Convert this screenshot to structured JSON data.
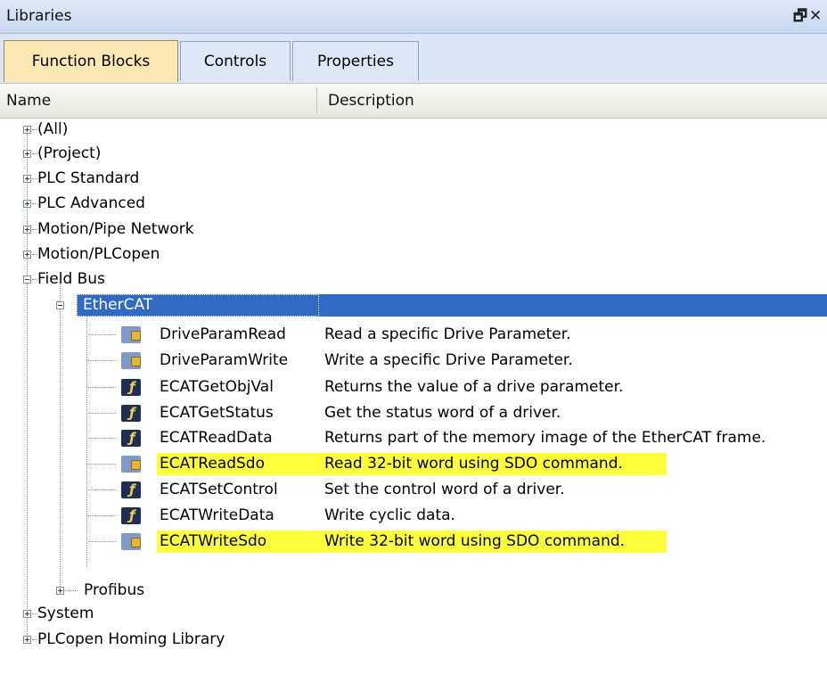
{
  "window": {
    "title": "Libraries",
    "pin_glyph": "🗗",
    "close_glyph": "✕"
  },
  "tabs": [
    {
      "label": "Function Blocks",
      "active": true
    },
    {
      "label": "Controls",
      "active": false
    },
    {
      "label": "Properties",
      "active": false
    }
  ],
  "columns": {
    "name": "Name",
    "description": "Description"
  },
  "tree": {
    "top_level": [
      {
        "label": "(All)",
        "expanded": false
      },
      {
        "label": "(Project)",
        "expanded": false
      },
      {
        "label": "PLC Standard",
        "expanded": false
      },
      {
        "label": "PLC Advanced",
        "expanded": false
      },
      {
        "label": "Motion/Pipe Network",
        "expanded": false
      },
      {
        "label": "Motion/PLCopen",
        "expanded": false
      },
      {
        "label": "Field Bus",
        "expanded": true
      },
      {
        "label": "System",
        "expanded": false
      },
      {
        "label": "PLCopen Homing Library",
        "expanded": false
      }
    ],
    "fieldbus_children": [
      {
        "label": "EtherCAT",
        "expanded": true,
        "selected": true
      },
      {
        "label": "Profibus",
        "expanded": false
      }
    ],
    "ethercat_blocks": [
      {
        "name": "DriveParamRead",
        "description": "Read a specific Drive Parameter.",
        "icon": "sdo-block-icon",
        "highlighted": false
      },
      {
        "name": "DriveParamWrite",
        "description": "Write a specific Drive Parameter.",
        "icon": "sdo-block-icon",
        "highlighted": false
      },
      {
        "name": "ECATGetObjVal",
        "description": "Returns the value of a drive parameter.",
        "icon": "function-block-icon",
        "highlighted": false
      },
      {
        "name": "ECATGetStatus",
        "description": "Get the status word of a driver.",
        "icon": "function-block-icon",
        "highlighted": false
      },
      {
        "name": "ECATReadData",
        "description": "Returns part of the memory image of the EtherCAT frame.",
        "icon": "function-block-icon",
        "highlighted": false
      },
      {
        "name": "ECATReadSdo",
        "description": "Read 32-bit word using SDO command.",
        "icon": "sdo-block-icon",
        "highlighted": true
      },
      {
        "name": "ECATSetControl",
        "description": "Set the control word of a driver.",
        "icon": "function-block-icon",
        "highlighted": false
      },
      {
        "name": "ECATWriteData",
        "description": "Write cyclic data.",
        "icon": "function-block-icon",
        "highlighted": false
      },
      {
        "name": "ECATWriteSdo",
        "description": "Write 32-bit word using SDO command.",
        "icon": "sdo-block-icon",
        "highlighted": true
      }
    ]
  },
  "colors": {
    "selection": "#316ac5",
    "highlight": "#ffff3c",
    "active_tab": "#fbe7b4"
  }
}
